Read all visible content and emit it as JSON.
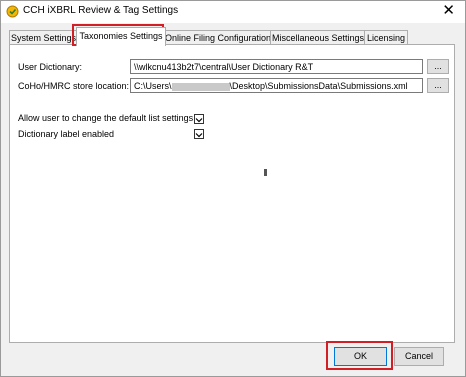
{
  "window": {
    "title": "CCH iXBRL Review & Tag Settings",
    "close_glyph": "✕",
    "icon": "app-logo-icon"
  },
  "tabs": [
    {
      "label": "System Settings",
      "active": false
    },
    {
      "label": "Taxonomies Settings",
      "active": true
    },
    {
      "label": "Online Filing Configuration",
      "active": false
    },
    {
      "label": "Miscellaneous Settings",
      "active": false
    },
    {
      "label": "Licensing",
      "active": false
    }
  ],
  "fields": {
    "user_dictionary": {
      "label": "User Dictionary:",
      "value": "\\\\wlkcnu413b2t7\\central\\User Dictionary R&T",
      "browse_label": "..."
    },
    "coho_store": {
      "label": "CoHo/HMRC store location:",
      "value_prefix": "C:\\Users\\",
      "value_suffix": "\\Desktop\\SubmissionsData\\Submissions.xml",
      "browse_label": "..."
    }
  },
  "checkboxes": [
    {
      "label": "Allow user to change the default list settings",
      "checked": true
    },
    {
      "label": "Dictionary label enabled",
      "checked": true
    }
  ],
  "buttons": {
    "ok": "OK",
    "cancel": "Cancel"
  },
  "colors": {
    "highlight": "#d21f26",
    "default_button_border": "#0078d7"
  }
}
